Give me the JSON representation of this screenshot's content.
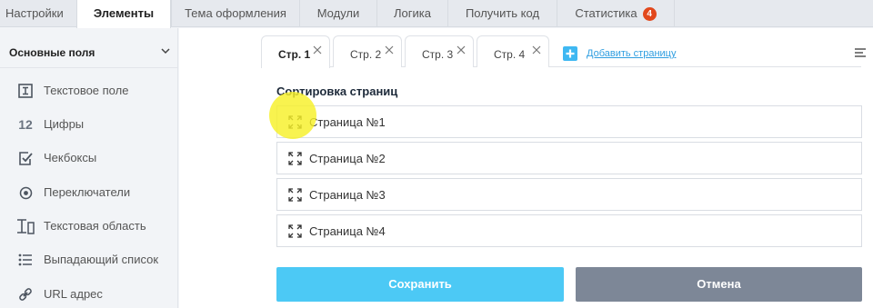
{
  "top_tabs": [
    {
      "label": "Настройки"
    },
    {
      "label": "Элементы"
    },
    {
      "label": "Тема оформления"
    },
    {
      "label": "Модули"
    },
    {
      "label": "Логика"
    },
    {
      "label": "Получить код"
    },
    {
      "label": "Статистика",
      "badge": "4"
    }
  ],
  "sidebar": {
    "header": "Основные поля",
    "items": [
      {
        "label": "Текстовое поле",
        "icon": "text-field-icon"
      },
      {
        "label": "Цифры",
        "icon": "numbers-icon",
        "icon_text": "12"
      },
      {
        "label": "Чекбоксы",
        "icon": "checkbox-icon"
      },
      {
        "label": "Переключатели",
        "icon": "radio-icon"
      },
      {
        "label": "Текстовая область",
        "icon": "textarea-icon"
      },
      {
        "label": "Выпадающий список",
        "icon": "list-icon"
      },
      {
        "label": "URL адрес",
        "icon": "link-icon"
      }
    ]
  },
  "page_tabs": [
    {
      "label": "Стр. 1"
    },
    {
      "label": "Стр. 2"
    },
    {
      "label": "Стр. 3"
    },
    {
      "label": "Стр. 4"
    }
  ],
  "add_page_label": "Добавить страницу",
  "sort_title": "Сортировка страниц",
  "pages": [
    {
      "label": "Страница №1"
    },
    {
      "label": "Страница №2"
    },
    {
      "label": "Страница №3"
    },
    {
      "label": "Страница №4"
    }
  ],
  "buttons": {
    "save": "Сохранить",
    "cancel": "Отмена"
  },
  "colors": {
    "accent": "#4cc9f5",
    "cancel": "#7d8797",
    "badge": "#e2481c",
    "link": "#2f9ee0"
  }
}
